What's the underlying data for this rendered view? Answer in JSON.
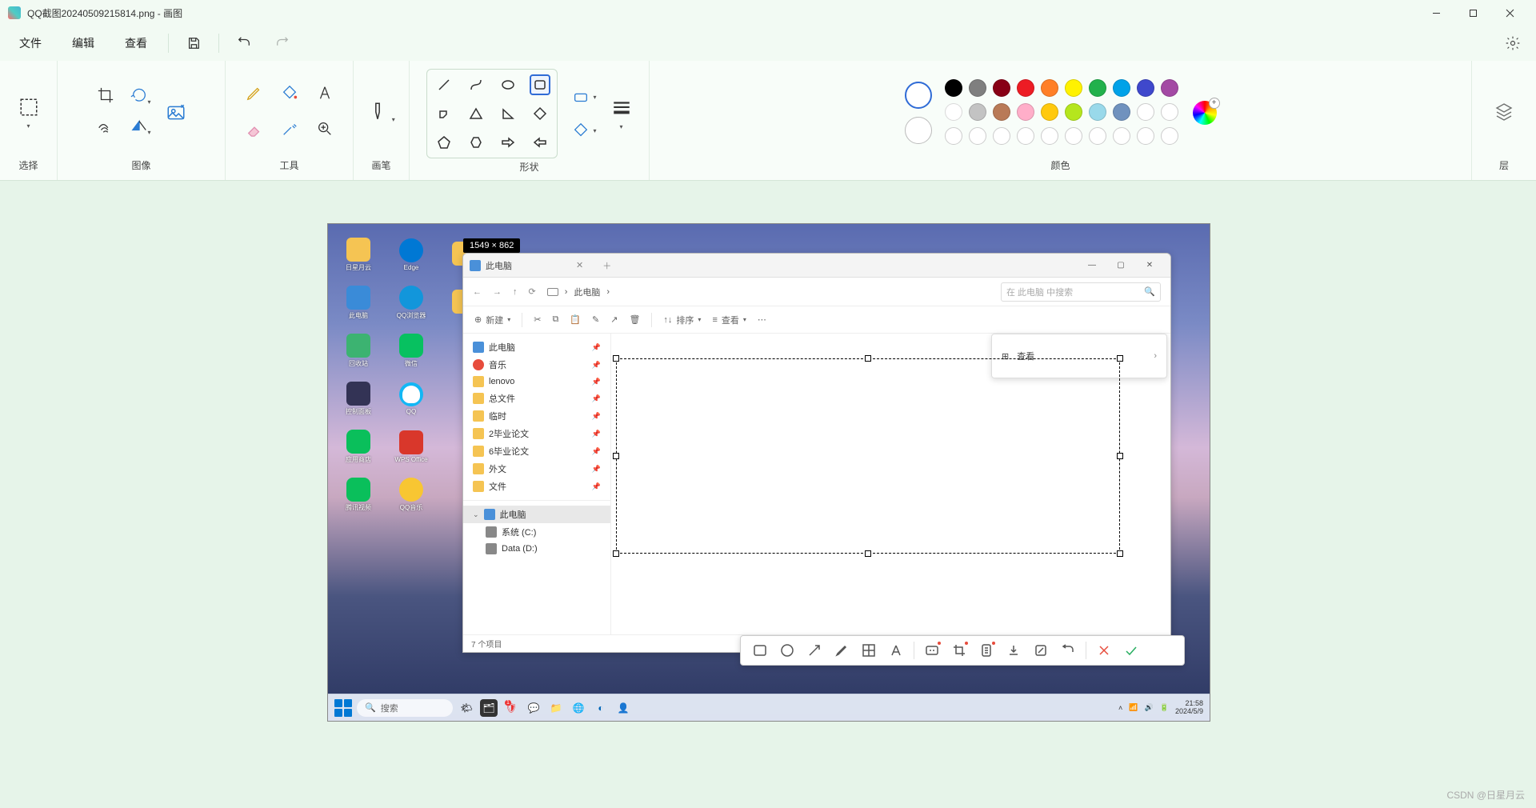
{
  "app": {
    "title": "QQ截图20240509215814.png - 画图"
  },
  "window_controls": {
    "min": "—",
    "max": "▢",
    "close": "✕"
  },
  "menubar": {
    "file": "文件",
    "edit": "编辑",
    "view": "查看"
  },
  "ribbon": {
    "select": "选择",
    "image": "图像",
    "tools": "工具",
    "brush": "画笔",
    "shapes": "形状",
    "colors": "颜色",
    "layers": "层"
  },
  "palette": {
    "row1": [
      "#000000",
      "#7f7f7f",
      "#880015",
      "#ed1c24",
      "#ff7f27",
      "#fff200",
      "#22b14c",
      "#00a2e8",
      "#3f48cc",
      "#a349a4"
    ],
    "row2": [
      "#ffffff",
      "#c3c3c3",
      "#b97a57",
      "#ffaec9",
      "#ffc90e",
      "#b5e61d",
      "#99d9ea",
      "#7092be",
      "",
      ""
    ]
  },
  "canvas": {
    "size_label": "1549 × 862"
  },
  "explorer": {
    "title": "此电脑",
    "breadcrumb": "此电脑",
    "search_placeholder": "在 此电脑 中搜索",
    "toolbar": {
      "new": "新建",
      "sort": "排序",
      "view": "查看"
    },
    "view_popup": "查看",
    "sidebar_quick": [
      "此电脑",
      "音乐",
      "lenovo",
      "总文件",
      "临时",
      "2毕业论文",
      "6毕业论文",
      "外文",
      "文件"
    ],
    "sidebar_pc": "此电脑",
    "drives": [
      "系统 (C:)",
      "Data (D:)"
    ],
    "status": "7 个项目"
  },
  "taskbar": {
    "search": "搜索",
    "time": "21:58",
    "date": "2024/5/9"
  },
  "desktop": {
    "icons": [
      "日星月云",
      "Edge",
      "",
      "此电脑",
      "QQ浏览器",
      "",
      "回收站",
      "微信",
      "",
      "控制面板",
      "QQ",
      "",
      "应用商店",
      "WPS Office",
      "",
      "腾讯视频",
      "QQ音乐"
    ]
  },
  "watermark": "CSDN @日星月云"
}
